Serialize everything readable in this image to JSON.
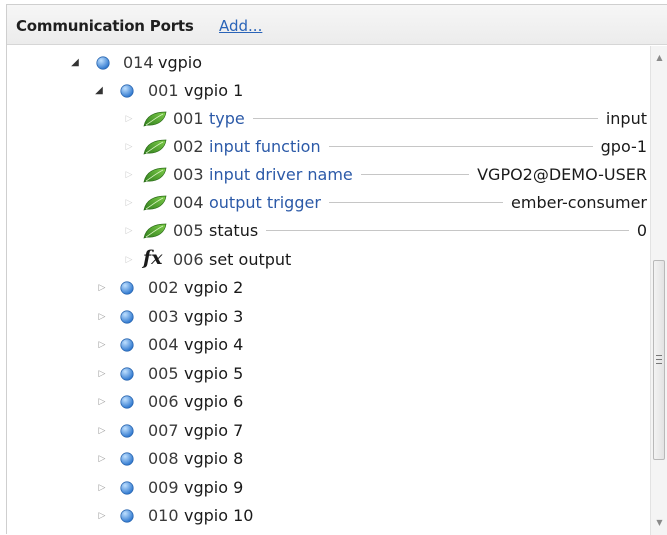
{
  "panel": {
    "title": "Communication Ports",
    "add_link": "Add..."
  },
  "colors": {
    "parameter_label": "#2c5aa8",
    "link": "#2a64b8",
    "node_blue": "#3f86d6",
    "leaf_green": "#3f9a2a"
  },
  "tree": {
    "root": {
      "number": "014",
      "label": "vgpio",
      "icon": "blue-node-icon",
      "expanded": true
    },
    "child": {
      "number": "001",
      "label": "vgpio 1",
      "icon": "blue-node-icon",
      "expanded": true
    },
    "parameters": [
      {
        "number": "001",
        "label": "type",
        "value": "input",
        "icon": "leaf-icon",
        "style": "param"
      },
      {
        "number": "002",
        "label": "input function",
        "value": "gpo-1",
        "icon": "leaf-icon",
        "style": "param"
      },
      {
        "number": "003",
        "label": "input driver name",
        "value": "VGPO2@DEMO-USER",
        "icon": "leaf-icon",
        "style": "param"
      },
      {
        "number": "004",
        "label": "output trigger",
        "value": "ember-consumer",
        "icon": "leaf-icon",
        "style": "param"
      },
      {
        "number": "005",
        "label": "status",
        "value": "0",
        "icon": "leaf-icon",
        "style": "plain"
      }
    ],
    "function": {
      "number": "006",
      "label": "set output",
      "icon": "function-fx-icon",
      "glyph": "fx"
    },
    "siblings": [
      {
        "number": "002",
        "label": "vgpio 2"
      },
      {
        "number": "003",
        "label": "vgpio 3"
      },
      {
        "number": "004",
        "label": "vgpio 4"
      },
      {
        "number": "005",
        "label": "vgpio 5"
      },
      {
        "number": "006",
        "label": "vgpio 6"
      },
      {
        "number": "007",
        "label": "vgpio 7"
      },
      {
        "number": "008",
        "label": "vgpio 8"
      },
      {
        "number": "009",
        "label": "vgpio 9"
      },
      {
        "number": "010",
        "label": "vgpio 10"
      }
    ]
  }
}
